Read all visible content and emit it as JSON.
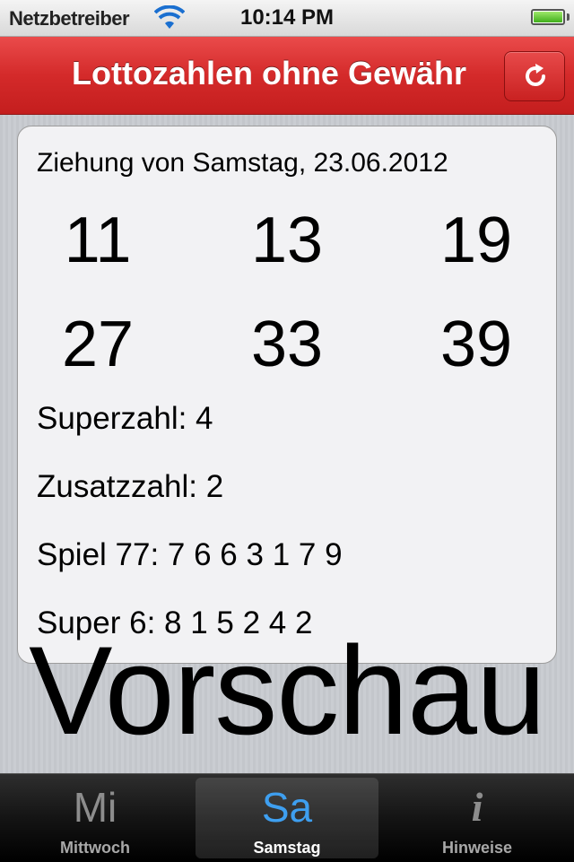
{
  "status_bar": {
    "carrier": "Netzbetreiber",
    "time": "10:14 PM",
    "wifi_icon": "wifi-icon",
    "battery_level": 1.0,
    "battery_color": "#3fae1a"
  },
  "nav_bar": {
    "title": "Lottozahlen ohne Gewähr",
    "refresh_icon": "refresh-icon",
    "accent_color": "#d42a2a"
  },
  "draw": {
    "heading": "Ziehung von Samstag, 23.06.2012",
    "numbers": [
      "11",
      "13",
      "19",
      "27",
      "33",
      "39"
    ],
    "superzahl": "Superzahl: 4",
    "zusatzzahl": "Zusatzzahl: 2",
    "spiel77": "Spiel 77: 7 6 6 3 1 7 9",
    "super6": "Super 6: 8 1 5 2 4 2"
  },
  "watermark": "Vorschau",
  "tab_bar": {
    "tabs": [
      {
        "icon_text": "Mi",
        "label": "Mittwoch",
        "selected": false
      },
      {
        "icon_text": "Sa",
        "label": "Samstag",
        "selected": true
      },
      {
        "icon_text": "i",
        "label": "Hinweise",
        "selected": false
      }
    ],
    "selected_color": "#3e9ff0"
  }
}
